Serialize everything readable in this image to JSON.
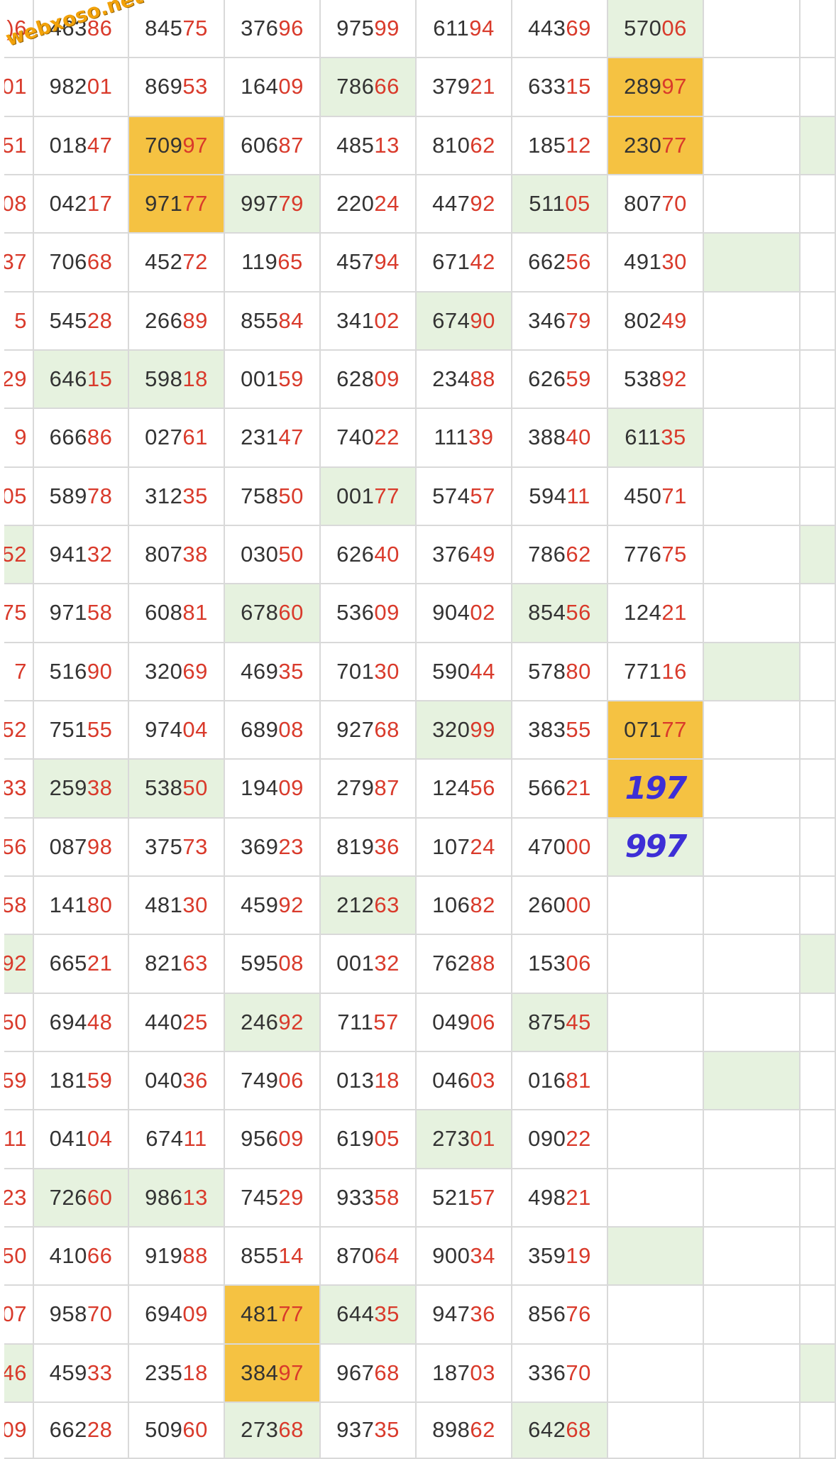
{
  "watermark": "webxoso.net",
  "colors": {
    "number_text": "#333333",
    "tail_digits": "#d93a2b",
    "green_cell": "#e6f2df",
    "orange_cell": "#f5c242",
    "handwriting": "#3d2fd6"
  },
  "columns": 10,
  "rows": [
    {
      "c": [
        ")6",
        "46386",
        "84575",
        "37696",
        "97599",
        "61194",
        "44369",
        "57006",
        "",
        ""
      ],
      "bg": {
        "7": "g"
      }
    },
    {
      "c": [
        "01",
        "98201",
        "86953",
        "16409",
        "78666",
        "37921",
        "63315",
        "28997",
        "",
        ""
      ],
      "bg": {
        "4": "g",
        "7": "o"
      }
    },
    {
      "c": [
        "51",
        "01847",
        "70997",
        "60687",
        "48513",
        "81062",
        "18512",
        "23077",
        "",
        ""
      ],
      "bg": {
        "2": "o",
        "7": "o",
        "9": "g"
      }
    },
    {
      "c": [
        "08",
        "04217",
        "97177",
        "99779",
        "22024",
        "44792",
        "51105",
        "80770",
        "",
        ""
      ],
      "bg": {
        "2": "o",
        "3": "g",
        "6": "g"
      }
    },
    {
      "c": [
        "37",
        "70668",
        "45272",
        "11965",
        "45794",
        "67142",
        "66256",
        "49130",
        "",
        ""
      ],
      "bg": {
        "8": "g"
      }
    },
    {
      "c": [
        "5",
        "54528",
        "26689",
        "85584",
        "34102",
        "67490",
        "34679",
        "80249",
        "",
        ""
      ],
      "bg": {
        "5": "g"
      }
    },
    {
      "c": [
        "29",
        "64615",
        "59818",
        "00159",
        "62809",
        "23488",
        "62659",
        "53892",
        "",
        ""
      ],
      "bg": {
        "1": "g",
        "2": "g"
      }
    },
    {
      "c": [
        "9",
        "66686",
        "02761",
        "23147",
        "74022",
        "11139",
        "38840",
        "61135",
        "",
        ""
      ],
      "bg": {
        "7": "g"
      }
    },
    {
      "c": [
        "05",
        "58978",
        "31235",
        "75850",
        "00177",
        "57457",
        "59411",
        "45071",
        "",
        ""
      ],
      "bg": {
        "4": "g"
      }
    },
    {
      "c": [
        "52",
        "94132",
        "80738",
        "03050",
        "62640",
        "37649",
        "78662",
        "77675",
        "",
        ""
      ],
      "bg": {
        "0": "g",
        "9": "g"
      }
    },
    {
      "c": [
        "75",
        "97158",
        "60881",
        "67860",
        "53609",
        "90402",
        "85456",
        "12421",
        "",
        ""
      ],
      "bg": {
        "3": "g",
        "6": "g"
      }
    },
    {
      "c": [
        "7",
        "51690",
        "32069",
        "46935",
        "70130",
        "59044",
        "57880",
        "77116",
        "",
        ""
      ],
      "bg": {
        "8": "g"
      }
    },
    {
      "c": [
        "52",
        "75155",
        "97404",
        "68908",
        "92768",
        "32099",
        "38355",
        "07177",
        "",
        ""
      ],
      "bg": {
        "5": "g",
        "7": "o"
      }
    },
    {
      "c": [
        "33",
        "25938",
        "53850",
        "19409",
        "27987",
        "12456",
        "56621",
        "197",
        "",
        ""
      ],
      "bg": {
        "1": "g",
        "2": "g",
        "7": "o"
      },
      "hw": 7
    },
    {
      "c": [
        "56",
        "08798",
        "37573",
        "36923",
        "81936",
        "10724",
        "47000",
        "997",
        "",
        ""
      ],
      "bg": {
        "7": "g"
      },
      "hw": 7
    },
    {
      "c": [
        "58",
        "14180",
        "48130",
        "45992",
        "21263",
        "10682",
        "26000",
        "",
        "",
        ""
      ],
      "bg": {
        "4": "g"
      }
    },
    {
      "c": [
        "92",
        "66521",
        "82163",
        "59508",
        "00132",
        "76288",
        "15306",
        "",
        "",
        ""
      ],
      "bg": {
        "0": "g",
        "9": "g"
      }
    },
    {
      "c": [
        "50",
        "69448",
        "44025",
        "24692",
        "71157",
        "04906",
        "87545",
        "",
        "",
        ""
      ],
      "bg": {
        "3": "g",
        "6": "g"
      }
    },
    {
      "c": [
        "59",
        "18159",
        "04036",
        "74906",
        "01318",
        "04603",
        "01681",
        "",
        "",
        ""
      ],
      "bg": {
        "8": "g"
      }
    },
    {
      "c": [
        "11",
        "04104",
        "67411",
        "95609",
        "61905",
        "27301",
        "09022",
        "",
        "",
        ""
      ],
      "bg": {
        "5": "g"
      }
    },
    {
      "c": [
        "23",
        "72660",
        "98613",
        "74529",
        "93358",
        "52157",
        "49821",
        "",
        "",
        ""
      ],
      "bg": {
        "1": "g",
        "2": "g"
      }
    },
    {
      "c": [
        "50",
        "41066",
        "91988",
        "85514",
        "87064",
        "90034",
        "35919",
        "",
        "",
        ""
      ],
      "bg": {
        "7": "g"
      }
    },
    {
      "c": [
        "07",
        "95870",
        "69409",
        "48177",
        "64435",
        "94736",
        "85676",
        "",
        "",
        ""
      ],
      "bg": {
        "3": "o",
        "4": "g"
      }
    },
    {
      "c": [
        "46",
        "45933",
        "23518",
        "38497",
        "96768",
        "18703",
        "33670",
        "",
        "",
        ""
      ],
      "bg": {
        "0": "g",
        "3": "o",
        "9": "g"
      }
    },
    {
      "c": [
        "09",
        "66228",
        "50960",
        "27368",
        "93735",
        "89862",
        "64268",
        "",
        "",
        ""
      ],
      "bg": {
        "3": "g",
        "6": "g"
      }
    }
  ]
}
